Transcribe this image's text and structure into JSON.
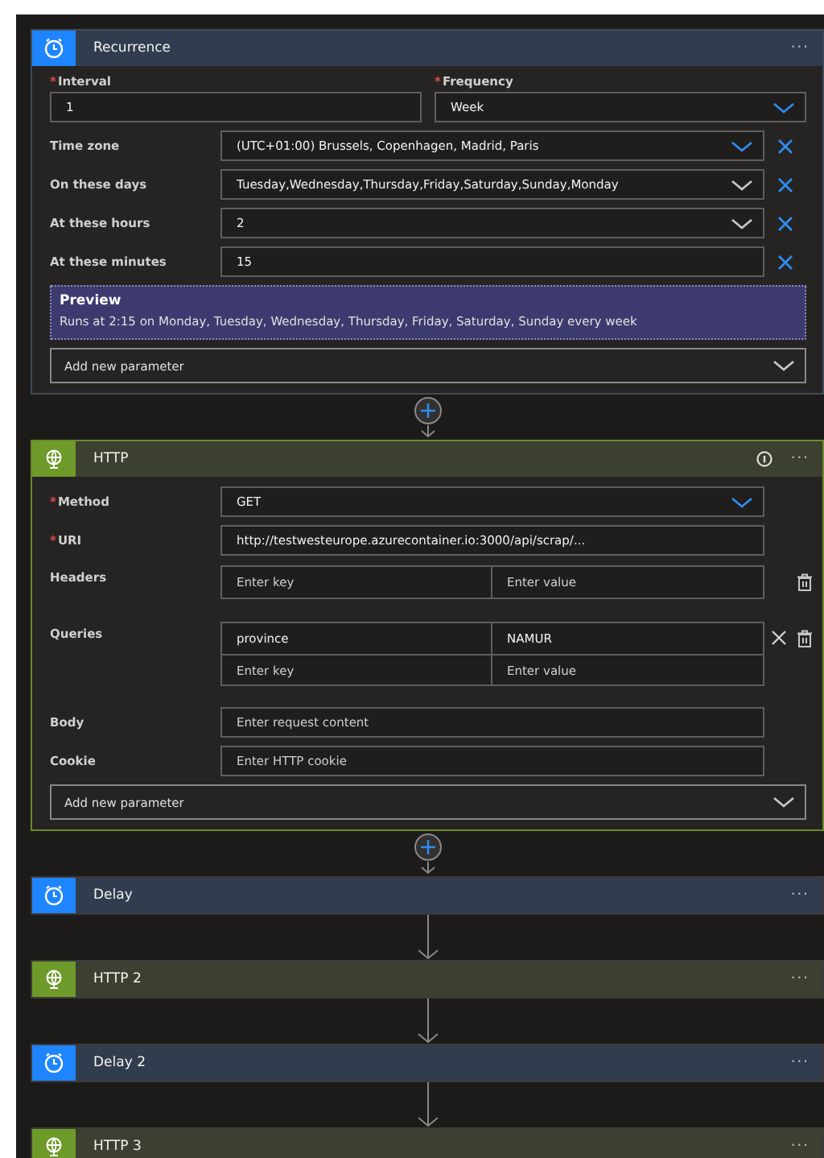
{
  "steps": [
    {
      "kind": "schedule",
      "title": "Recurrence",
      "more": "···",
      "expanded": true,
      "info": false,
      "fields": [
        {
          "kind": "pair",
          "items": [
            {
              "label": "Interval",
              "marker": "*",
              "kind": "text",
              "value": "1"
            },
            {
              "label": "Frequency",
              "marker": "*",
              "kind": "select",
              "value": "Week",
              "highlighted": true
            }
          ]
        },
        {
          "kind": "select",
          "label": "Time zone",
          "value": "(UTC+01:00) Brussels, Copenhagen, Madrid, Paris",
          "highlighted": true,
          "removable": true
        },
        {
          "kind": "select",
          "label": "On these days",
          "value": "Tuesday,Wednesday,Thursday,Friday,Saturday,Sunday,Monday",
          "highlighted": false,
          "removable": true
        },
        {
          "kind": "select",
          "label": "At these hours",
          "value": "2",
          "highlighted": false,
          "removable": true
        },
        {
          "kind": "text",
          "label": "At these minutes",
          "value": "15",
          "removable": true
        },
        {
          "kind": "preview",
          "title": "Preview",
          "text": "Runs at 2:15 on Monday, Tuesday, Wednesday, Thursday, Friday, Saturday, Sunday every week"
        }
      ],
      "add_parameter": "Add new parameter"
    },
    {
      "kind": "http",
      "title": "HTTP",
      "more": "···",
      "add_button": true,
      "expanded": true,
      "info": true,
      "fields": [
        {
          "kind": "select",
          "label": "Method",
          "marker": "*",
          "value": "GET",
          "highlighted": true,
          "removable": false
        },
        {
          "kind": "text",
          "label": "URI",
          "marker": "*",
          "value": "http://testwesteurope.azurecontainer.io:3000/api/scrap/...",
          "removable": false
        },
        {
          "kind": "pairs",
          "label": "Headers",
          "entries": [
            {
              "key_placeholder": "Enter key",
              "value_placeholder": "Enter value",
              "removable": false
            }
          ]
        },
        {
          "kind": "pairs",
          "label": "Queries",
          "entries": [
            {
              "key": "province",
              "value": "NAMUR",
              "removable": true
            },
            {
              "key_placeholder": "Enter key",
              "value_placeholder": "Enter value",
              "removable": false
            }
          ]
        },
        {
          "kind": "text",
          "label": "Body",
          "placeholder": "Enter request content",
          "removable": false
        },
        {
          "kind": "text",
          "label": "Cookie",
          "placeholder": "Enter HTTP cookie",
          "removable": false
        }
      ],
      "add_parameter": "Add new parameter"
    },
    {
      "kind": "schedule",
      "title": "Delay",
      "more": "···",
      "add_button": true,
      "expanded": false,
      "info": false
    },
    {
      "kind": "http",
      "title": "HTTP 2",
      "more": "···",
      "add_button": false,
      "expanded": false,
      "info": false
    },
    {
      "kind": "schedule",
      "title": "Delay 2",
      "more": "···",
      "add_button": false,
      "expanded": false,
      "info": false
    },
    {
      "kind": "http",
      "title": "HTTP 3",
      "more": "···",
      "add_button": false,
      "expanded": false,
      "info": false
    }
  ]
}
